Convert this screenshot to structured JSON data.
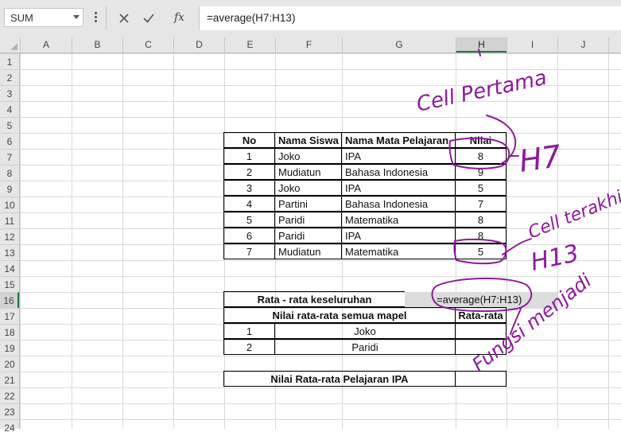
{
  "name_box": {
    "value": "SUM"
  },
  "formula_bar": {
    "formula": "=average(H7:H13)",
    "fx_label": "fx"
  },
  "columns": [
    "A",
    "B",
    "C",
    "D",
    "E",
    "F",
    "G",
    "H",
    "I",
    "J"
  ],
  "rows": [
    "1",
    "2",
    "3",
    "4",
    "5",
    "6",
    "7",
    "8",
    "9",
    "10",
    "11",
    "12",
    "13",
    "14",
    "15",
    "16",
    "17",
    "18",
    "19",
    "20",
    "21",
    "22",
    "23",
    "24"
  ],
  "table_students": {
    "headers": {
      "no": "No",
      "nama_siswa": "Nama Siswa",
      "mata_pelajaran": "Nama Mata Pelajaran",
      "nilai": "Nilai"
    },
    "rows": [
      {
        "no": "1",
        "nama": "Joko",
        "mapel": "IPA",
        "nilai": "8"
      },
      {
        "no": "2",
        "nama": "Mudiatun",
        "mapel": "Bahasa Indonesia",
        "nilai": "9"
      },
      {
        "no": "3",
        "nama": "Joko",
        "mapel": "IPA",
        "nilai": "5"
      },
      {
        "no": "4",
        "nama": "Partini",
        "mapel": "Bahasa Indonesia",
        "nilai": "7"
      },
      {
        "no": "5",
        "nama": "Paridi",
        "mapel": "Matematika",
        "nilai": "8"
      },
      {
        "no": "6",
        "nama": "Paridi",
        "mapel": "IPA",
        "nilai": "8"
      },
      {
        "no": "7",
        "nama": "Mudiatun",
        "mapel": "Matematika",
        "nilai": "5"
      }
    ]
  },
  "summary": {
    "overall_label": "Rata - rata keseluruhan",
    "editing_formula": "=average(H7:H13)",
    "per_subject_label": "Nilai rata-rata semua mapel",
    "rata_rata_label": "Rata-rata",
    "students": [
      {
        "no": "1",
        "name": "Joko"
      },
      {
        "no": "2",
        "name": "Paridi"
      }
    ],
    "ipa_label": "Nilai Rata-rata Pelajaran IPA"
  },
  "annotations": {
    "cell_pertama": "Cell Pertama",
    "h7": "H7",
    "cell_terakhir": "Cell terakhir",
    "h13": "H13",
    "fungsi_menjadi": "Fungsi menjadi"
  },
  "colors": {
    "ink": "#8e1a9c",
    "excel_green": "#217346",
    "header_gray": "#e6e6e6"
  }
}
